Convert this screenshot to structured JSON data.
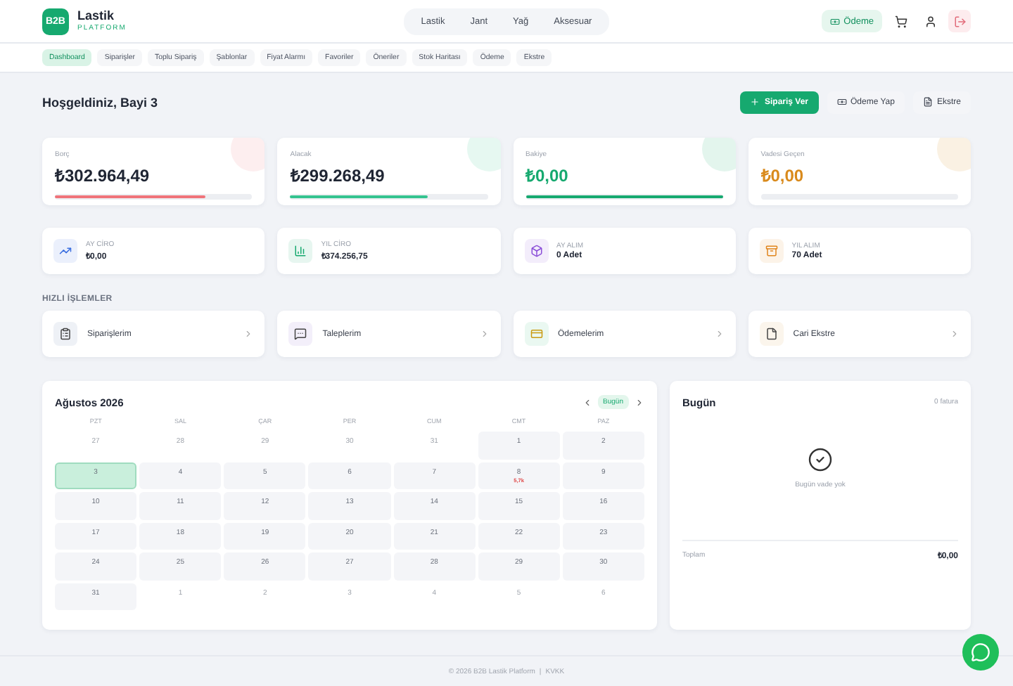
{
  "brand": {
    "logo": "B2B",
    "name": "Lastik",
    "tagline": "PLATFORM"
  },
  "top_nav": [
    {
      "label": "Lastik",
      "selected": false
    },
    {
      "label": "Jant",
      "selected": false
    },
    {
      "label": "Yağ",
      "selected": false
    },
    {
      "label": "Aksesuar",
      "selected": false
    }
  ],
  "payment_button": "Ödeme",
  "sub_nav": [
    {
      "label": "Dashboard",
      "selected": true
    },
    {
      "label": "Siparişler",
      "selected": false
    },
    {
      "label": "Toplu Sipariş",
      "selected": false
    },
    {
      "label": "Şablonlar",
      "selected": false
    },
    {
      "label": "Fiyat Alarmı",
      "selected": false
    },
    {
      "label": "Favoriler",
      "selected": false
    },
    {
      "label": "Öneriler",
      "selected": false
    },
    {
      "label": "Stok Haritası",
      "selected": false
    },
    {
      "label": "Ödeme",
      "selected": false
    },
    {
      "label": "Ekstre",
      "selected": false
    }
  ],
  "greeting": "Hoşgeldiniz, Bayi 3",
  "actions": [
    {
      "label": "Sipariş Ver",
      "kind": "primary"
    },
    {
      "label": "Ödeme Yap",
      "kind": "payment"
    },
    {
      "label": "Ekstre",
      "kind": "statement"
    }
  ],
  "balances": [
    {
      "label": "Borç",
      "value": "₺302.964,49",
      "color": "#f0737a",
      "level": 0.76,
      "value_colored": false
    },
    {
      "label": "Alacak",
      "value": "₺299.268,49",
      "color": "#34c38f",
      "level": 0.7,
      "value_colored": false
    },
    {
      "label": "Bakiye",
      "value": "₺0,00",
      "color": "#16a96f",
      "level": 1,
      "value_colored": true
    },
    {
      "label": "Vadesi Geçen",
      "value": "₺0,00",
      "color": "#d98a1c",
      "value_colored": true
    }
  ],
  "stats": [
    {
      "label": "AY CİRO",
      "value": "₺0,00",
      "kind": "trend",
      "color": "#3b6fe0"
    },
    {
      "label": "YIL CİRO",
      "value": "₺374.256,75",
      "kind": "chart",
      "color": "#16a96f"
    },
    {
      "label": "AY ALIM",
      "value": "0 Adet",
      "kind": "box",
      "color": "#8b4fd8"
    },
    {
      "label": "YIL ALIM",
      "value": "70 Adet",
      "kind": "archive",
      "color": "#e0851c"
    }
  ],
  "quick_title": "HIZLI İŞLEMLER",
  "quick": [
    {
      "label": "Siparişlerim",
      "kind": "clipboard"
    },
    {
      "label": "Taleplerim",
      "kind": "chat"
    },
    {
      "label": "Ödemelerim",
      "kind": "card"
    },
    {
      "label": "Cari Ekstre",
      "kind": "document"
    }
  ],
  "calendar": {
    "title": "Ağustos 2026",
    "today_button": "Bugün",
    "weekdays": [
      "PZT",
      "SAL",
      "ÇAR",
      "PER",
      "CUM",
      "CMT",
      "PAZ"
    ],
    "days": [
      {
        "day": "27",
        "kind": "outside",
        "selected": false
      },
      {
        "day": "28",
        "kind": "outside",
        "selected": false
      },
      {
        "day": "29",
        "kind": "outside",
        "selected": false
      },
      {
        "day": "30",
        "kind": "outside",
        "selected": false
      },
      {
        "day": "31",
        "kind": "outside",
        "selected": false
      },
      {
        "day": "1",
        "kind": "month",
        "selected": false
      },
      {
        "day": "2",
        "kind": "month",
        "selected": false
      },
      {
        "day": "3",
        "kind": "month",
        "selected": true
      },
      {
        "day": "4",
        "kind": "month",
        "selected": false
      },
      {
        "day": "5",
        "kind": "month",
        "selected": false
      },
      {
        "day": "6",
        "kind": "month",
        "selected": false
      },
      {
        "day": "7",
        "kind": "month",
        "selected": false
      },
      {
        "day": "8",
        "kind": "month",
        "selected": false,
        "amount": "5,7k"
      },
      {
        "day": "9",
        "kind": "month",
        "selected": false
      },
      {
        "day": "10",
        "kind": "month",
        "selected": false
      },
      {
        "day": "11",
        "kind": "month",
        "selected": false
      },
      {
        "day": "12",
        "kind": "month",
        "selected": false
      },
      {
        "day": "13",
        "kind": "month",
        "selected": false
      },
      {
        "day": "14",
        "kind": "month",
        "selected": false
      },
      {
        "day": "15",
        "kind": "month",
        "selected": false
      },
      {
        "day": "16",
        "kind": "month",
        "selected": false
      },
      {
        "day": "17",
        "kind": "month",
        "selected": false
      },
      {
        "day": "18",
        "kind": "month",
        "selected": false
      },
      {
        "day": "19",
        "kind": "month",
        "selected": false
      },
      {
        "day": "20",
        "kind": "month",
        "selected": false
      },
      {
        "day": "21",
        "kind": "month",
        "selected": false
      },
      {
        "day": "22",
        "kind": "month",
        "selected": false
      },
      {
        "day": "23",
        "kind": "month",
        "selected": false
      },
      {
        "day": "24",
        "kind": "month",
        "selected": false
      },
      {
        "day": "25",
        "kind": "month",
        "selected": false
      },
      {
        "day": "26",
        "kind": "month",
        "selected": false
      },
      {
        "day": "27",
        "kind": "month",
        "selected": false
      },
      {
        "day": "28",
        "kind": "month",
        "selected": false
      },
      {
        "day": "29",
        "kind": "month",
        "selected": false
      },
      {
        "day": "30",
        "kind": "month",
        "selected": false
      },
      {
        "day": "31",
        "kind": "month",
        "selected": false
      },
      {
        "day": "1",
        "kind": "outside",
        "selected": false
      },
      {
        "day": "2",
        "kind": "outside",
        "selected": false
      },
      {
        "day": "3",
        "kind": "outside",
        "selected": false
      },
      {
        "day": "4",
        "kind": "outside",
        "selected": false
      },
      {
        "day": "5",
        "kind": "outside",
        "selected": false
      },
      {
        "day": "6",
        "kind": "outside",
        "selected": false
      }
    ]
  },
  "today_panel": {
    "title": "Bugün",
    "count": "0 fatura",
    "empty": "Bugün vade yok",
    "total_label": "Toplam",
    "total": "₺0,00"
  },
  "footer": {
    "text": "© 2026 B2B Lastik Platform",
    "separator": "|",
    "link": "KVKK"
  }
}
